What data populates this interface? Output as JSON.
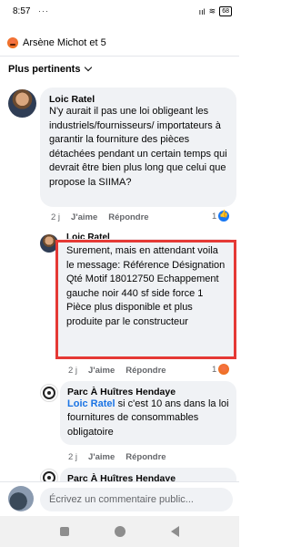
{
  "status_bar": {
    "time": "8:57",
    "notification_dots": "···",
    "signal": "ııl",
    "wifi": "≋",
    "battery": "68"
  },
  "reactions_header": {
    "text": "Arsène Michot et 5"
  },
  "sort": {
    "label": "Plus pertinents"
  },
  "comments": [
    {
      "author": "Loic Ratel",
      "text": "N'y aurait il pas une loi obligeant les industriels/fournisseurs/ importateurs à garantir la fourniture des pièces détachées pendant un certain temps qui devrait être bien plus long que celui que propose la SIIMA?",
      "time": "2 j",
      "like_label": "J'aime",
      "reply_label": "Répondre",
      "like_count": "1"
    },
    {
      "author": "Loic Ratel",
      "text": "Surement, mais en attendant voila le message: Référence Désignation Qté Motif 18012750 Echappement gauche noir 440 sf side force 1 Pièce plus disponible et plus produite par le constructeur",
      "time": "2 j",
      "like_label": "J'aime",
      "reply_label": "Répondre",
      "like_count": "1"
    },
    {
      "author": "Parc À Huîtres Hendaye",
      "mention": "Loic Ratel",
      "text": " si c'est 10 ans dans la loi fournitures de consommables obligatoire",
      "time": "2 j",
      "like_label": "J'aime",
      "reply_label": "Répondre"
    },
    {
      "author": "Parc À Huîtres Hendaye"
    }
  ],
  "composer": {
    "placeholder": "Écrivez un commentaire public..."
  },
  "colors": {
    "highlight": "#e53935",
    "like_blue": "#1877f2",
    "mention": "#1b74e4"
  }
}
